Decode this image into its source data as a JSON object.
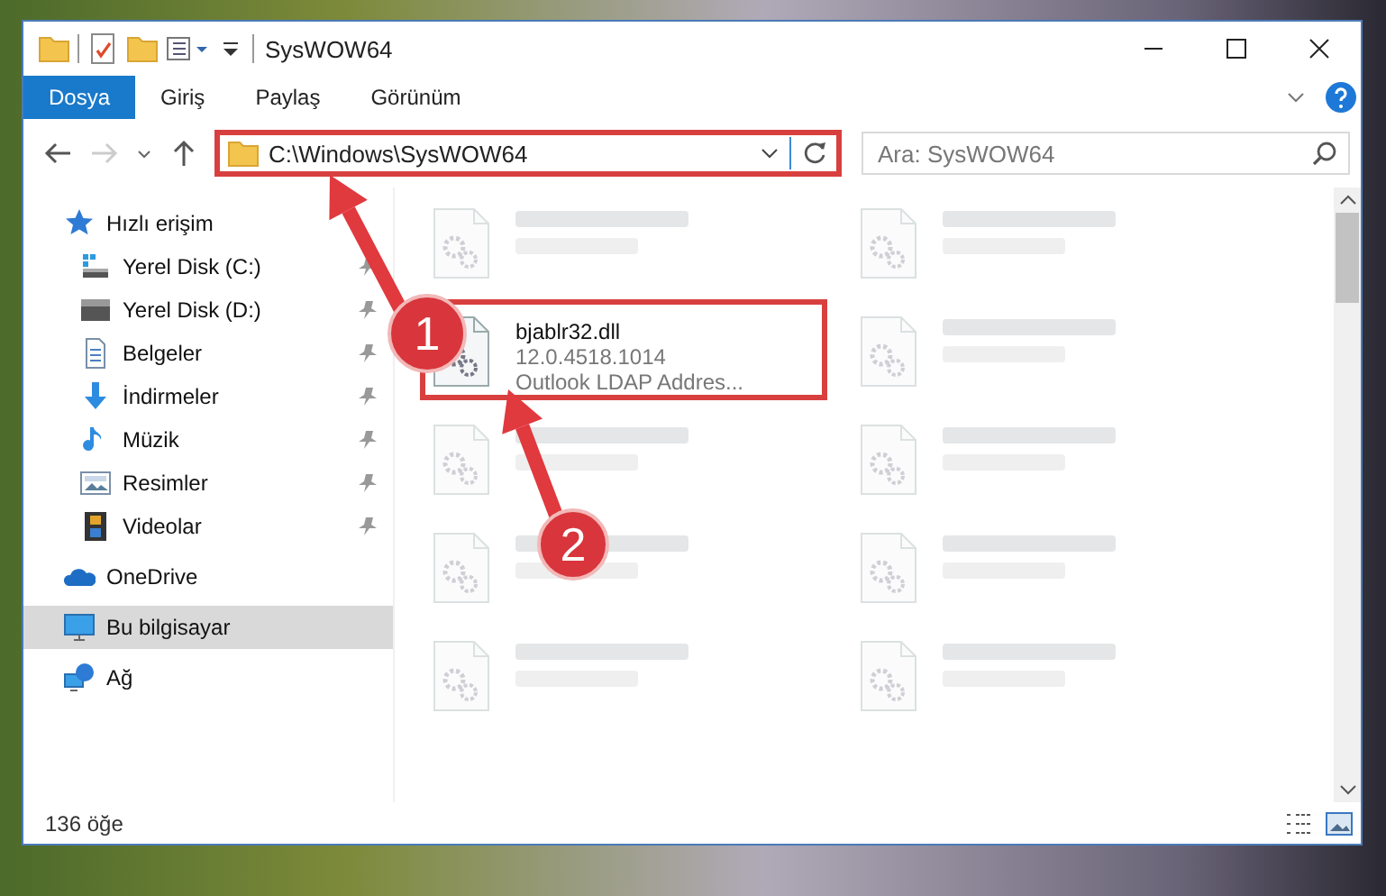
{
  "window": {
    "title": "SysWOW64"
  },
  "ribbon_tabs": [
    {
      "label": "Dosya",
      "selected": true
    },
    {
      "label": "Giriş",
      "selected": false
    },
    {
      "label": "Paylaş",
      "selected": false
    },
    {
      "label": "Görünüm",
      "selected": false
    }
  ],
  "address_bar": {
    "path": "C:\\Windows\\SysWOW64",
    "highlighted": true
  },
  "search": {
    "placeholder": "Ara: SysWOW64"
  },
  "sidebar": {
    "items": [
      {
        "label": "Hızlı erişim",
        "selected": false,
        "children": [
          {
            "label": "Yerel Disk (C:)",
            "pinned": true
          },
          {
            "label": "Yerel Disk (D:)",
            "pinned": true
          },
          {
            "label": "Belgeler",
            "pinned": true
          },
          {
            "label": "İndirmeler",
            "pinned": true
          },
          {
            "label": "Müzik",
            "pinned": true
          },
          {
            "label": "Resimler",
            "pinned": true
          },
          {
            "label": "Videolar",
            "pinned": true
          }
        ]
      },
      {
        "label": "OneDrive",
        "selected": false
      },
      {
        "label": "Bu bilgisayar",
        "selected": true
      },
      {
        "label": "Ağ",
        "selected": false
      }
    ]
  },
  "files": [
    {
      "blurred": true,
      "highlighted": false
    },
    {
      "blurred": true,
      "highlighted": false
    },
    {
      "lines": [
        "bjablr32.dll",
        "12.0.4518.1014",
        "Outlook LDAP Addres..."
      ],
      "blurred": false,
      "highlighted": true
    },
    {
      "blurred": true,
      "highlighted": false
    },
    {
      "blurred": true,
      "highlighted": false
    },
    {
      "blurred": true,
      "highlighted": false
    },
    {
      "blurred": true,
      "highlighted": false
    },
    {
      "blurred": true,
      "highlighted": false
    },
    {
      "blurred": true,
      "highlighted": false
    },
    {
      "blurred": true,
      "highlighted": false
    }
  ],
  "status_bar": {
    "item_count": "136 öğe"
  },
  "annotations": [
    {
      "number": "1"
    },
    {
      "number": "2"
    }
  ]
}
